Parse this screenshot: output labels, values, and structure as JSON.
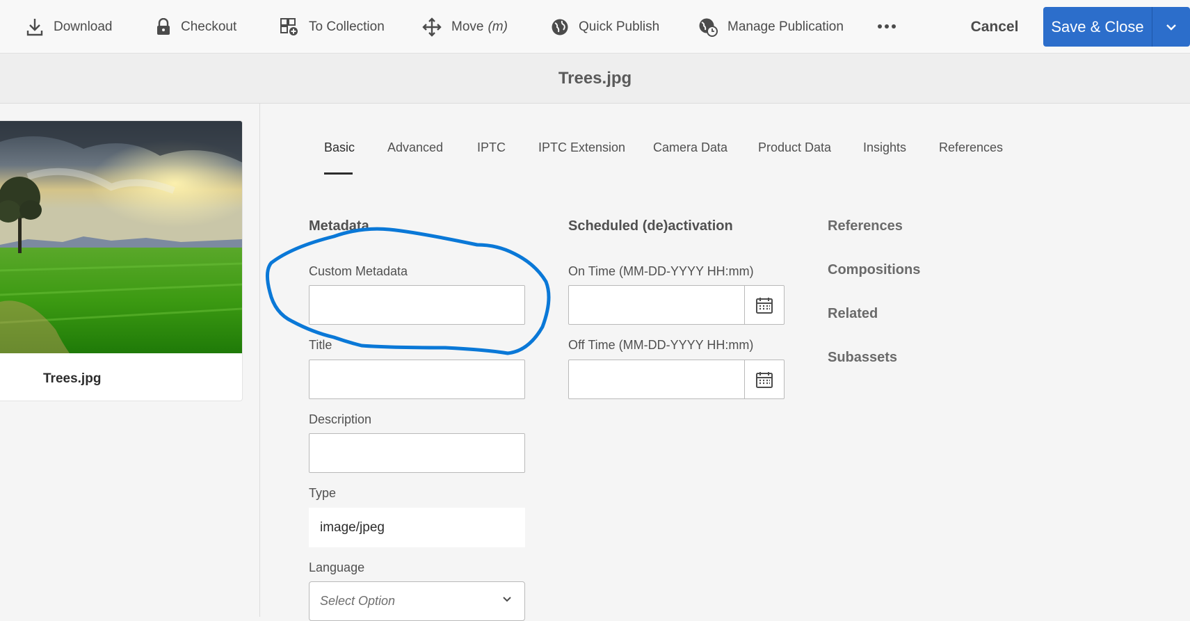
{
  "toolbar": {
    "download": "Download",
    "checkout": "Checkout",
    "to_collection": "To Collection",
    "move": "Move",
    "move_shortcut": "(m)",
    "quick_publish": "Quick Publish",
    "manage_publication": "Manage Publication",
    "cancel": "Cancel",
    "save_close": "Save & Close"
  },
  "title": "Trees.jpg",
  "asset_card": {
    "name": "Trees.jpg"
  },
  "tabs": [
    "Basic",
    "Advanced",
    "IPTC",
    "IPTC Extension",
    "Camera Data",
    "Product Data",
    "Insights",
    "References"
  ],
  "active_tab": "Basic",
  "metadata": {
    "heading": "Metadata",
    "custom_metadata_label": "Custom Metadata",
    "custom_metadata_value": "",
    "title_label": "Title",
    "title_value": "",
    "description_label": "Description",
    "description_value": "",
    "type_label": "Type",
    "type_value": "image/jpeg",
    "language_label": "Language",
    "language_placeholder": "Select Option"
  },
  "scheduled": {
    "heading": "Scheduled (de)activation",
    "on_time_label": "On Time (MM-DD-YYYY HH:mm)",
    "off_time_label": "Off Time (MM-DD-YYYY HH:mm)"
  },
  "references_panel": {
    "heading": "References",
    "links": [
      "Compositions",
      "Related",
      "Subassets"
    ]
  },
  "colors": {
    "accent": "#2c6ecb",
    "annotation": "#0a78d7"
  }
}
